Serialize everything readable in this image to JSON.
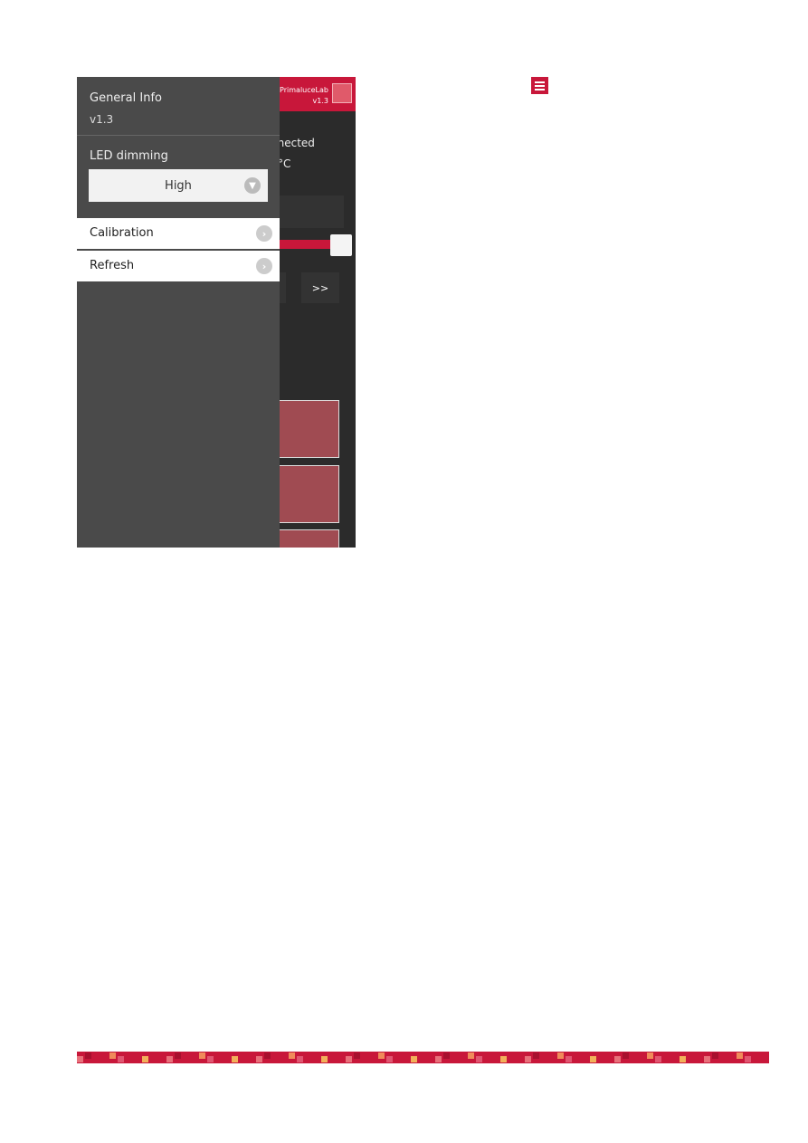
{
  "app": {
    "brand": "PrimaluceLab",
    "version": "v1.3"
  },
  "background": {
    "status_partial": "nnected",
    "temp_partial": "°C",
    "next_button": ">>"
  },
  "drawer": {
    "general_info_label": "General Info",
    "version": "v1.3",
    "led_label": "LED dimming",
    "led_value": "High",
    "items": [
      {
        "label": "Calibration"
      },
      {
        "label": "Refresh"
      }
    ]
  },
  "colors": {
    "accent": "#c8173a",
    "drawer": "#4a4a4a",
    "app_bg": "#2b2b2b",
    "tile": "#a04b52"
  },
  "icons": {
    "menu": "hamburger-icon",
    "select": "chevron-down-icon",
    "item": "chevron-right-icon"
  }
}
